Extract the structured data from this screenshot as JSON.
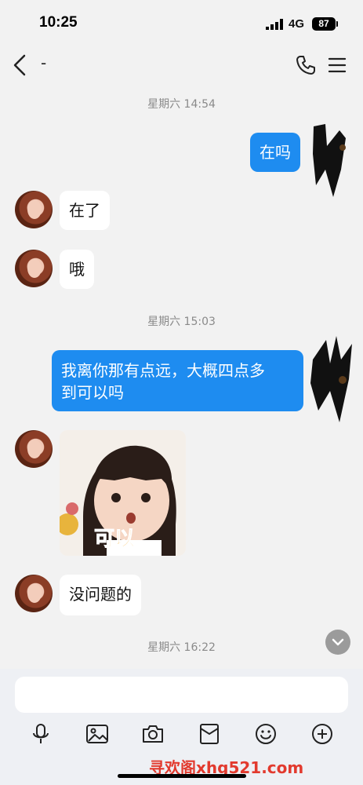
{
  "status_bar": {
    "time": "10:25",
    "network": "4G",
    "battery": "87"
  },
  "header": {
    "contact_name": "-"
  },
  "messages": {
    "ts1": "星期六 14:54",
    "out1": "在吗",
    "in1": "在了",
    "in2": "哦",
    "ts2": "星期六 15:03",
    "out2_line1": "我离你那有点远，大概四点多",
    "out2_line2": "到可以吗",
    "sticker_caption": "可以",
    "in3": "没问题的",
    "ts3": "星期六 16:22"
  },
  "composer": {
    "placeholder": ""
  },
  "watermark": "寻欢阁xhg521.com",
  "colors": {
    "outgoing": "#1e8cf0",
    "incoming": "#ffffff",
    "background": "#f2f2f2"
  }
}
